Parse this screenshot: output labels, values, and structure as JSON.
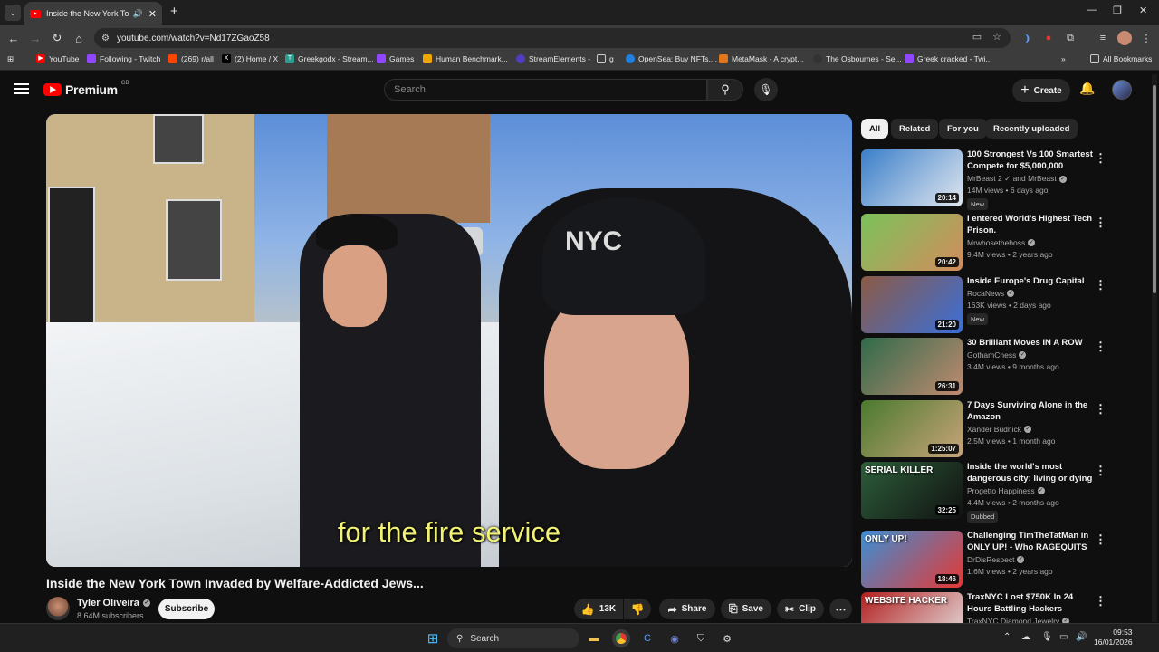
{
  "browser": {
    "tab_title": "Inside the New York Town I",
    "url": "youtube.com/watch?v=Nd17ZGaoZ58",
    "bookmarks": [
      {
        "label": "YouTube",
        "color": "#ff0000"
      },
      {
        "label": "Following - Twitch",
        "color": "#9146ff"
      },
      {
        "label": "(269) r/all",
        "color": "#ff4500"
      },
      {
        "label": "(2) Home / X",
        "color": "#000000"
      },
      {
        "label": "Greekgodx - Stream...",
        "color": "#2a9d8f"
      },
      {
        "label": "Games",
        "color": "#9146ff"
      },
      {
        "label": "Human Benchmark...",
        "color": "#f0a500"
      },
      {
        "label": "StreamElements -",
        "color": "#4f3ec2"
      },
      {
        "label": "g",
        "color": "#555555"
      },
      {
        "label": "OpenSea: Buy NFTs,...",
        "color": "#2081e2"
      },
      {
        "label": "MetaMask - A crypt...",
        "color": "#e2761b"
      },
      {
        "label": "The Osbournes - Se...",
        "color": "#333333"
      },
      {
        "label": "Greek cracked - Twi...",
        "color": "#9146ff"
      }
    ],
    "all_bookmarks": "All Bookmarks"
  },
  "youtube": {
    "logo_text": "Premium",
    "logo_region": "GB",
    "search_placeholder": "Search",
    "create_label": "Create"
  },
  "video": {
    "caption": "for the fire service",
    "title": "Inside the New York Town Invaded by Welfare-Addicted Jews...",
    "channel": "Tyler Oliveira",
    "subscribers": "8.64M subscribers",
    "subscribe_label": "Subscribe",
    "likes": "13K",
    "share_label": "Share",
    "save_label": "Save",
    "clip_label": "Clip"
  },
  "chips": [
    "All",
    "Related",
    "For you",
    "Recently uploaded"
  ],
  "recommendations": [
    {
      "title": "100 Strongest Vs 100 Smartest Compete for $5,000,000",
      "channel": "MrBeast 2 ✓ and MrBeast",
      "meta": "14M views • 6 days ago",
      "duration": "20:14",
      "badge": "New",
      "colors": [
        "#3a7fc9",
        "#e0e6ee"
      ]
    },
    {
      "title": "I entered World's Highest Tech Prison.",
      "channel": "Mrwhosetheboss",
      "meta": "9.4M views • 2 years ago",
      "duration": "20:42",
      "badge": "",
      "colors": [
        "#7ac35a",
        "#d38b5d"
      ]
    },
    {
      "title": "Inside Europe's Drug Capital",
      "channel": "RocaNews",
      "meta": "163K views • 2 days ago",
      "duration": "21:20",
      "badge": "New",
      "colors": [
        "#8c5a44",
        "#3b6fd9"
      ]
    },
    {
      "title": "30 Brilliant Moves IN A ROW",
      "channel": "GothamChess",
      "meta": "3.4M views • 9 months ago",
      "duration": "26:31",
      "badge": "",
      "colors": [
        "#2f6b4a",
        "#c08a70"
      ]
    },
    {
      "title": "7 Days Surviving Alone in the Amazon",
      "channel": "Xander Budnick",
      "meta": "2.5M views • 1 month ago",
      "duration": "1:25:07",
      "badge": "",
      "colors": [
        "#4a7a2e",
        "#c9a37a"
      ]
    },
    {
      "title": "Inside the world's most dangerous city: living or dying ...",
      "channel": "Progetto Happiness",
      "meta": "4.4M views • 2 months ago",
      "duration": "32:25",
      "badge": "Dubbed",
      "thumb_text": "SERIAL    KILLER",
      "colors": [
        "#2c5e3a",
        "#111111"
      ]
    },
    {
      "title": "Challenging TimTheTatMan in ONLY UP! - Who RAGEQUITS ...",
      "channel": "DrDisRespect",
      "meta": "1.6M views • 2 years ago",
      "duration": "18:46",
      "badge": "",
      "thumb_text": "ONLY UP!",
      "colors": [
        "#3a8fd6",
        "#e53935"
      ]
    },
    {
      "title": "TraxNYC Lost $750K In 24 Hours Battling Hackers",
      "channel": "TraxNYC Diamond Jewelry",
      "meta": "",
      "duration": "",
      "badge": "",
      "thumb_text": "WEBSITE HACKER",
      "colors": [
        "#b32020",
        "#e6e6e6"
      ]
    }
  ],
  "taskbar": {
    "search_label": "Search",
    "time": "09:53",
    "date": "16/01/2026"
  }
}
